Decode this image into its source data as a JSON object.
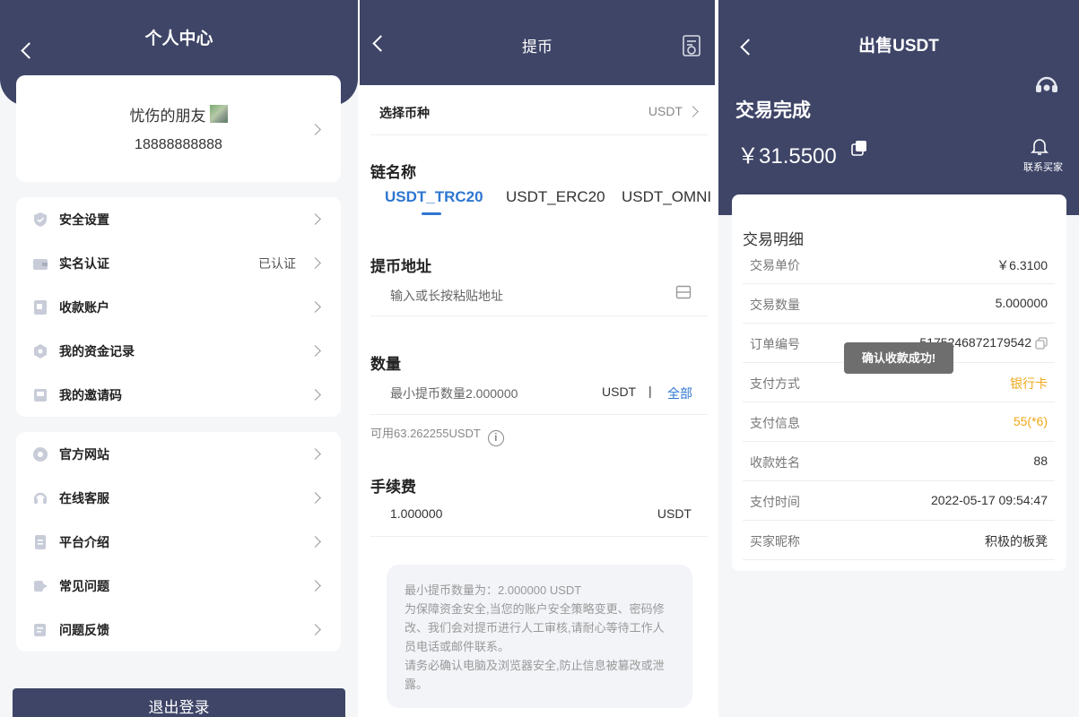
{
  "profile": {
    "title": "个人中心",
    "nickname": "忧伤的朋友",
    "phone": "18888888888",
    "menu1": [
      {
        "label": "安全设置",
        "value": "",
        "icon": "shield-icon"
      },
      {
        "label": "实名认证",
        "value": "已认证",
        "icon": "wallet-icon"
      },
      {
        "label": "收款账户",
        "value": "",
        "icon": "account-book-icon"
      },
      {
        "label": "我的资金记录",
        "value": "",
        "icon": "fund-record-icon"
      },
      {
        "label": "我的邀请码",
        "value": "",
        "icon": "invite-code-icon"
      }
    ],
    "menu2": [
      {
        "label": "官方网站",
        "icon": "globe-icon"
      },
      {
        "label": "在线客服",
        "icon": "headset-icon"
      },
      {
        "label": "平台介绍",
        "icon": "document-icon"
      },
      {
        "label": "常见问题",
        "icon": "faq-icon"
      },
      {
        "label": "问题反馈",
        "icon": "feedback-icon"
      }
    ],
    "logout": "退出登录"
  },
  "withdraw": {
    "title": "提币",
    "select_coin_label": "选择币种",
    "select_coin_value": "USDT",
    "chain_label": "链名称",
    "chains": [
      "USDT_TRC20",
      "USDT_ERC20",
      "USDT_OMNI"
    ],
    "address_label": "提币地址",
    "address_placeholder": "输入或长按粘贴地址",
    "amount_label": "数量",
    "amount_placeholder": "最小提币数量2.000000",
    "amount_unit": "USDT",
    "amount_separator": "|",
    "amount_all": "全部",
    "available": "可用63.262255USDT",
    "fee_label": "手续费",
    "fee_value": "1.000000",
    "fee_unit": "USDT",
    "notes": [
      "最小提币数量为：2.000000 USDT",
      "为保障资金安全,当您的账户安全策略变更、密码修改、我们会对提币进行人工审核,请耐心等待工作人员电话或邮件联系。",
      "请务必确认电脑及浏览器安全,防止信息被篡改或泄露。"
    ]
  },
  "sell": {
    "title": "出售USDT",
    "status": "交易完成",
    "amount": "￥31.5500",
    "contact_buyer": "联系买家",
    "detail_title": "交易明细",
    "details": [
      {
        "key": "交易单价",
        "value": "￥6.3100"
      },
      {
        "key": "交易数量",
        "value": "5.000000"
      },
      {
        "key": "订单编号",
        "value": "5175246872179542"
      },
      {
        "key": "支付方式",
        "value": "银行卡"
      },
      {
        "key": "支付信息",
        "value": "55(*6)"
      },
      {
        "key": "收款姓名",
        "value": "88"
      },
      {
        "key": "支付时间",
        "value": "2022-05-17 09:54:47"
      },
      {
        "key": "买家昵称",
        "value": "积极的板凳"
      }
    ],
    "toast": "确认收款成功!"
  },
  "colors": {
    "header_navy": "#3e4567",
    "accent_blue": "#2e76d1",
    "highlight_orange": "#f0a81a"
  }
}
